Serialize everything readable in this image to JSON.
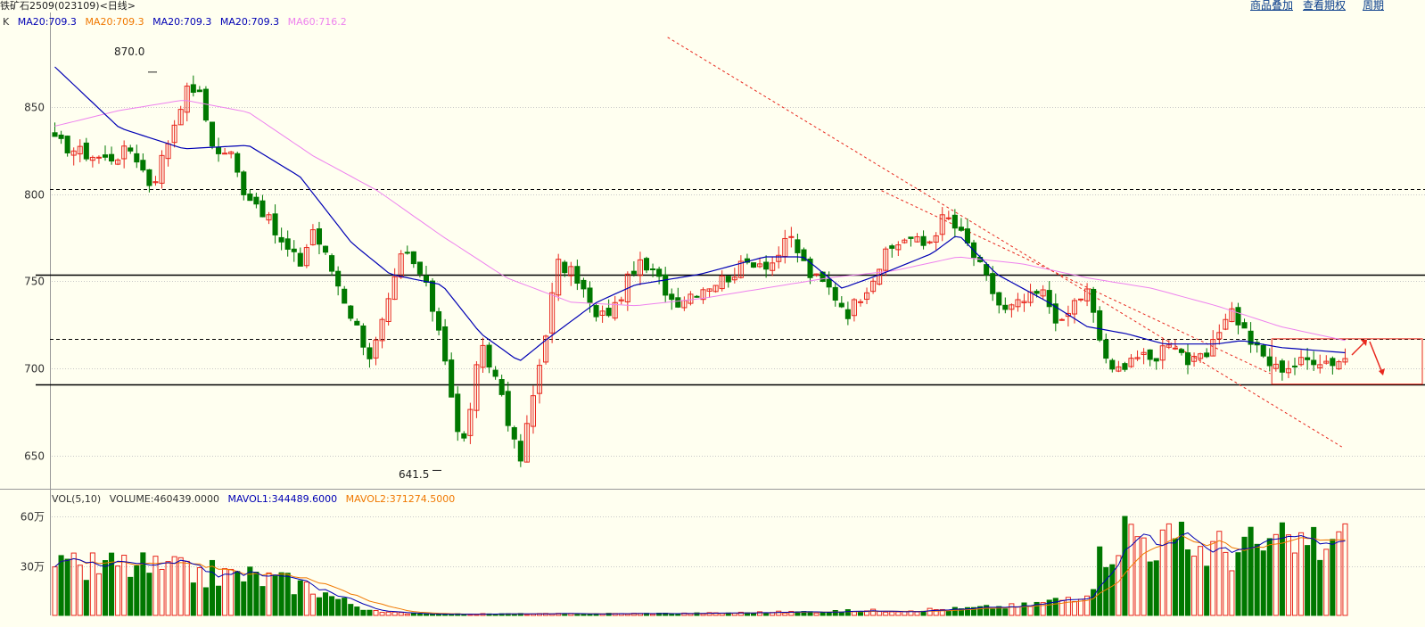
{
  "header": {
    "title": "铁矿石2509(023109)<日线>",
    "links": [
      "商品叠加",
      "查看期权",
      "周期"
    ]
  },
  "colors": {
    "up": "#e8281e",
    "down": "#007800",
    "ma20_line": "#0000b4",
    "ma60_line": "#ee82ee",
    "mavol1": "#0000b4",
    "mavol2": "#f07800",
    "trend_line": "#e8281e",
    "level_line": "#000000"
  },
  "legend": {
    "k": "K",
    "items": [
      {
        "text": "MA20:709.3",
        "color": "#0000b4"
      },
      {
        "text": "MA20:709.3",
        "color": "#f07800"
      },
      {
        "text": "MA20:709.3",
        "color": "#0000b4"
      },
      {
        "text": "MA20:709.3",
        "color": "#0000b4"
      },
      {
        "text": "MA60:716.2",
        "color": "#ee82ee"
      }
    ]
  },
  "vol_legend": {
    "items": [
      {
        "text": "VOL(5,10)",
        "color": "#333333"
      },
      {
        "text": "VOLUME:460439.0000",
        "color": "#333333"
      },
      {
        "text": "MAVOL1:344489.6000",
        "color": "#0000b4"
      },
      {
        "text": "MAVOL2:371274.5000",
        "color": "#f07800"
      }
    ]
  },
  "annotations": {
    "high": {
      "label": "870.0",
      "value": 870.0
    },
    "low": {
      "label": "641.5",
      "value": 641.5
    }
  },
  "chart_data": [
    {
      "type": "candlestick",
      "title": "铁矿石2509(023109)<日线>",
      "ylim": [
        632,
        895
      ],
      "y_ticks": [
        650,
        700,
        750,
        800,
        850
      ],
      "levels": {
        "solid": [
          754,
          691
        ],
        "dashed": [
          803,
          717
        ]
      },
      "trendlines": [
        {
          "from": [
            0.475,
            890
          ],
          "to": [
            0.995,
            655
          ]
        },
        {
          "from": [
            0.64,
            802
          ],
          "to": [
            0.94,
            697
          ]
        }
      ],
      "highlight_box": {
        "value_range": [
          691,
          717
        ]
      },
      "anchors": {
        "close": [
          [
            0,
            830
          ],
          [
            0.02,
            824
          ],
          [
            0.04,
            820
          ],
          [
            0.06,
            826
          ],
          [
            0.075,
            804
          ],
          [
            0.09,
            835
          ],
          [
            0.1,
            858
          ],
          [
            0.11,
            862
          ],
          [
            0.125,
            822
          ],
          [
            0.135,
            826
          ],
          [
            0.145,
            804
          ],
          [
            0.16,
            792
          ],
          [
            0.175,
            772
          ],
          [
            0.19,
            760
          ],
          [
            0.2,
            780
          ],
          [
            0.215,
            756
          ],
          [
            0.23,
            730
          ],
          [
            0.245,
            706
          ],
          [
            0.26,
            740
          ],
          [
            0.27,
            768
          ],
          [
            0.285,
            752
          ],
          [
            0.3,
            718
          ],
          [
            0.315,
            650
          ],
          [
            0.33,
            712
          ],
          [
            0.345,
            690
          ],
          [
            0.36,
            644
          ],
          [
            0.375,
            700
          ],
          [
            0.39,
            760
          ],
          [
            0.405,
            752
          ],
          [
            0.42,
            728
          ],
          [
            0.435,
            736
          ],
          [
            0.45,
            760
          ],
          [
            0.465,
            754
          ],
          [
            0.48,
            738
          ],
          [
            0.5,
            746
          ],
          [
            0.52,
            752
          ],
          [
            0.54,
            762
          ],
          [
            0.555,
            760
          ],
          [
            0.57,
            775
          ],
          [
            0.585,
            754
          ],
          [
            0.6,
            746
          ],
          [
            0.615,
            732
          ],
          [
            0.63,
            748
          ],
          [
            0.645,
            766
          ],
          [
            0.66,
            776
          ],
          [
            0.675,
            770
          ],
          [
            0.69,
            788
          ],
          [
            0.705,
            774
          ],
          [
            0.72,
            754
          ],
          [
            0.735,
            732
          ],
          [
            0.75,
            738
          ],
          [
            0.765,
            744
          ],
          [
            0.78,
            724
          ],
          [
            0.79,
            738
          ],
          [
            0.8,
            744
          ],
          [
            0.81,
            716
          ],
          [
            0.82,
            696
          ],
          [
            0.835,
            708
          ],
          [
            0.85,
            704
          ],
          [
            0.865,
            718
          ],
          [
            0.88,
            702
          ],
          [
            0.895,
            708
          ],
          [
            0.91,
            736
          ],
          [
            0.92,
            724
          ],
          [
            0.93,
            712
          ],
          [
            0.945,
            700
          ],
          [
            0.96,
            702
          ],
          [
            0.975,
            706
          ],
          [
            0.99,
            704
          ],
          [
            1,
            706
          ]
        ],
        "vol": [
          [
            0,
            28
          ],
          [
            0.05,
            32
          ],
          [
            0.1,
            27
          ],
          [
            0.15,
            25
          ],
          [
            0.2,
            18
          ],
          [
            0.22,
            10
          ],
          [
            0.25,
            2
          ],
          [
            0.3,
            0.8
          ],
          [
            0.4,
            1
          ],
          [
            0.5,
            1.3
          ],
          [
            0.6,
            2.5
          ],
          [
            0.7,
            4
          ],
          [
            0.75,
            6
          ],
          [
            0.78,
            10
          ],
          [
            0.8,
            17
          ],
          [
            0.815,
            45
          ],
          [
            0.83,
            55
          ],
          [
            0.86,
            46
          ],
          [
            0.9,
            42
          ],
          [
            0.95,
            44
          ],
          [
            1,
            46
          ]
        ],
        "ma20": [
          [
            0,
            873
          ],
          [
            0.05,
            838
          ],
          [
            0.1,
            826
          ],
          [
            0.15,
            828
          ],
          [
            0.19,
            810
          ],
          [
            0.23,
            772
          ],
          [
            0.26,
            754
          ],
          [
            0.3,
            748
          ],
          [
            0.33,
            720
          ],
          [
            0.36,
            704
          ],
          [
            0.38,
            716
          ],
          [
            0.42,
            738
          ],
          [
            0.45,
            748
          ],
          [
            0.5,
            754
          ],
          [
            0.55,
            764
          ],
          [
            0.58,
            764
          ],
          [
            0.61,
            746
          ],
          [
            0.64,
            754
          ],
          [
            0.68,
            766
          ],
          [
            0.7,
            777
          ],
          [
            0.73,
            754
          ],
          [
            0.77,
            738
          ],
          [
            0.8,
            724
          ],
          [
            0.83,
            720
          ],
          [
            0.86,
            714
          ],
          [
            0.9,
            714
          ],
          [
            0.92,
            716
          ],
          [
            0.95,
            712
          ],
          [
            1,
            709
          ]
        ],
        "ma60": [
          [
            0,
            839
          ],
          [
            0.05,
            848
          ],
          [
            0.1,
            854
          ],
          [
            0.15,
            847
          ],
          [
            0.2,
            822
          ],
          [
            0.25,
            802
          ],
          [
            0.3,
            776
          ],
          [
            0.35,
            752
          ],
          [
            0.4,
            738
          ],
          [
            0.45,
            736
          ],
          [
            0.5,
            740
          ],
          [
            0.55,
            746
          ],
          [
            0.6,
            752
          ],
          [
            0.65,
            756
          ],
          [
            0.7,
            764
          ],
          [
            0.75,
            760
          ],
          [
            0.8,
            752
          ],
          [
            0.85,
            746
          ],
          [
            0.9,
            736
          ],
          [
            0.95,
            724
          ],
          [
            1,
            716
          ]
        ]
      }
    },
    {
      "type": "bar",
      "title": "VOL(5,10)",
      "ylim": [
        0,
        65
      ],
      "y_ticks": [
        30,
        60
      ],
      "y_tick_labels": [
        "30万",
        "60万"
      ],
      "series": [
        {
          "name": "VOLUME",
          "last": 460439.0
        },
        {
          "name": "MAVOL1",
          "last": 344489.6
        },
        {
          "name": "MAVOL2",
          "last": 371274.5
        }
      ]
    }
  ]
}
